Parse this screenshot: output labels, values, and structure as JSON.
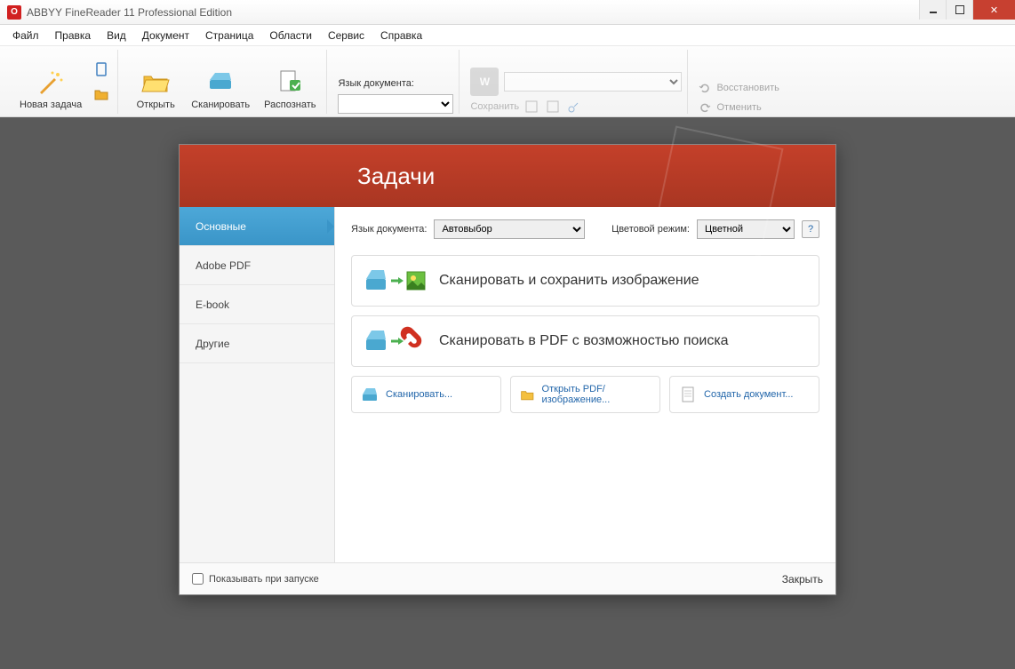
{
  "title": "ABBYY FineReader 11 Professional Edition",
  "menu": [
    "Файл",
    "Правка",
    "Вид",
    "Документ",
    "Страница",
    "Области",
    "Сервис",
    "Справка"
  ],
  "toolbar": {
    "new_task": "Новая задача",
    "open": "Открыть",
    "scan": "Сканировать",
    "recognize": "Распознать",
    "lang_label": "Язык документа:",
    "save": "Сохранить",
    "restore": "Восстановить",
    "undo": "Отменить"
  },
  "tasks": {
    "title": "Задачи",
    "tabs": [
      "Основные",
      "Adobe PDF",
      "E-book",
      "Другие"
    ],
    "lang_label": "Язык документа:",
    "lang_value": "Автовыбор",
    "color_label": "Цветовой режим:",
    "color_value": "Цветной",
    "card1": "Сканировать и сохранить изображение",
    "card2": "Сканировать в PDF с возможностью поиска",
    "mini1": "Сканировать...",
    "mini2": "Открыть PDF/изображение...",
    "mini3": "Создать документ...",
    "show_on_start": "Показывать при запуске",
    "close": "Закрыть"
  }
}
